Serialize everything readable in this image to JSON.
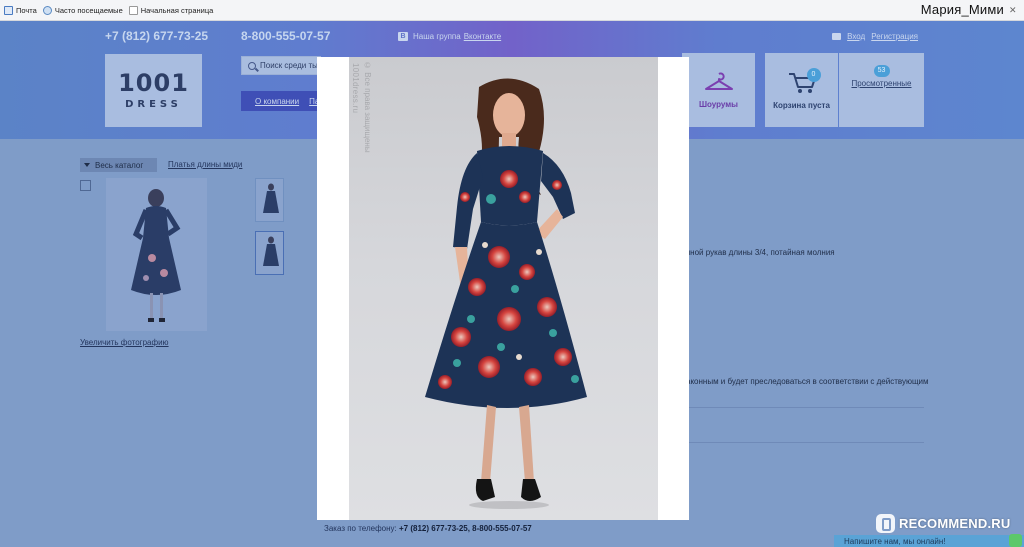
{
  "browser": {
    "bookmarks": [
      {
        "label": "Почта",
        "icon": "mail-icon"
      },
      {
        "label": "Часто посещаемые",
        "icon": "frequent-icon"
      },
      {
        "label": "Начальная страница",
        "icon": "home-page-icon"
      }
    ],
    "username": "Мария_Мими"
  },
  "header": {
    "phone_city": "+7 (812) 677-73-25",
    "phone_free": "8-800-555-07-57",
    "vk_prefix": "Наша группа",
    "vk_link": "Вконтакте",
    "login": "Вход",
    "register": "Регистрация",
    "logo_number": "1001",
    "logo_word": "DRESS",
    "search_placeholder": "Поиск среди ты",
    "nav": [
      "О компании",
      "Па"
    ],
    "showrooms_label": "Шоурумы",
    "cart_label": "Корзина пуста",
    "cart_count": "0",
    "viewed_count": "53",
    "viewed_label": "Просмотренные"
  },
  "page": {
    "catalog_button": "Весь каталог",
    "breadcrumb": "Платья длины миди",
    "enlarge_photo": "Увеличить фотографию",
    "description_line": "чной рукав длины 3/4, потайная молния",
    "legal_line": "аконным и будет преследоваться в соответствии с действующим",
    "order_prefix": "Заказ по телефону:",
    "order_phones": "+7 (812) 677-73-25, 8-800-555-07-57"
  },
  "lightbox": {
    "watermark_site": "1001dress.ru",
    "watermark_rights": "© Все права защищены"
  },
  "overlay": {
    "recommend_brand": "RECOMMEND.RU",
    "chat_text": "Напишите нам, мы онлайн!"
  },
  "colors": {
    "overlay_tint": "#7f9cc8",
    "header_gradient_mid": "#7262c9",
    "showroom_purple": "#6a3da8",
    "badge_blue": "#4a9fd8",
    "dress_navy": "#1d3356"
  }
}
